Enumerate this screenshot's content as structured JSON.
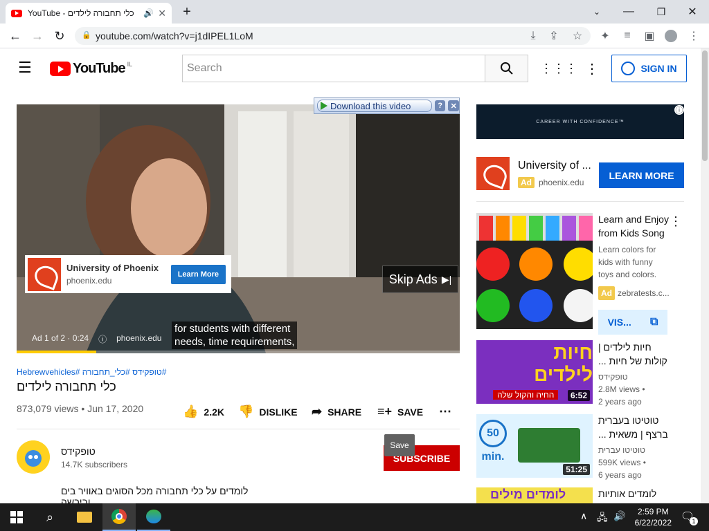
{
  "browser": {
    "tab_title": "כלי תחבורה לילדים - YouTube",
    "url": "youtube.com/watch?v=j1dIPEL1LoM"
  },
  "header": {
    "logo_text": "YouTube",
    "logo_region": "IL",
    "search_placeholder": "Search",
    "sign_in": "SIGN IN"
  },
  "player": {
    "download_label": "Download this video",
    "ad_card": {
      "title": "University of Phoenix",
      "url": "phoenix.edu",
      "button": "Learn More"
    },
    "skip_label": "Skip Ads",
    "subtitle_line1": "for students with different",
    "subtitle_line2": "needs, time requirements,",
    "ad_counter": "Ad 1 of 2 · 0:24",
    "ad_domain": "phoenix.edu",
    "progress": 0.18
  },
  "video": {
    "hashtags": "#טופקידס #כלי_תחבורה #Hebrewvehicles",
    "title": "כלי תחבורה לילדים",
    "meta": "873,079 views • Jun 17, 2020",
    "likes": "2.2K",
    "dislike": "DISLIKE",
    "share": "SHARE",
    "save": "SAVE"
  },
  "channel": {
    "name": "טופקידס",
    "subscribers": "14.7K subscribers",
    "subscribe": "SUBSCRIBE",
    "tooltip": "Save",
    "description": "לומדים על כלי תחבורה מכל הסוגים באוויר בים וביבשה"
  },
  "sidebar": {
    "banner_text": "CAREER WITH CONFIDENCE™",
    "ad": {
      "title": "University of ...",
      "badge": "Ad",
      "url": "phoenix.edu",
      "button": "LEARN MORE"
    },
    "promo": {
      "title": "Learn and Enjoy from Kids Song",
      "desc": "Learn colors for kids with funny toys and colors.",
      "badge": "Ad",
      "url": "zebratests.c...",
      "visit": "VIS..."
    },
    "videos": [
      {
        "title": "חיות לילדים | קולות של חיות ...",
        "channel": "טופקידס",
        "views": "2.8M views •",
        "age": "2 years ago",
        "duration": "6:52",
        "thumb_text": "חיות לילדים",
        "thumb_sub": "החיה והקול שלה"
      },
      {
        "title": "טוטיטו בעברית ברצף | משאית ...",
        "channel": "טוטיטו עברית",
        "views": "599K views •",
        "age": "6 years ago",
        "duration": "51:25",
        "thumb_text": "50 min."
      },
      {
        "title": "לומדים אותיות",
        "thumb_text": "לומדים מילים"
      }
    ]
  },
  "taskbar": {
    "time": "2:59 PM",
    "date": "6/22/2022",
    "notif_count": "1"
  },
  "colors": {
    "youtube_red": "#ff0000",
    "link_blue": "#065fd4",
    "subscribe_red": "#cc0000"
  }
}
